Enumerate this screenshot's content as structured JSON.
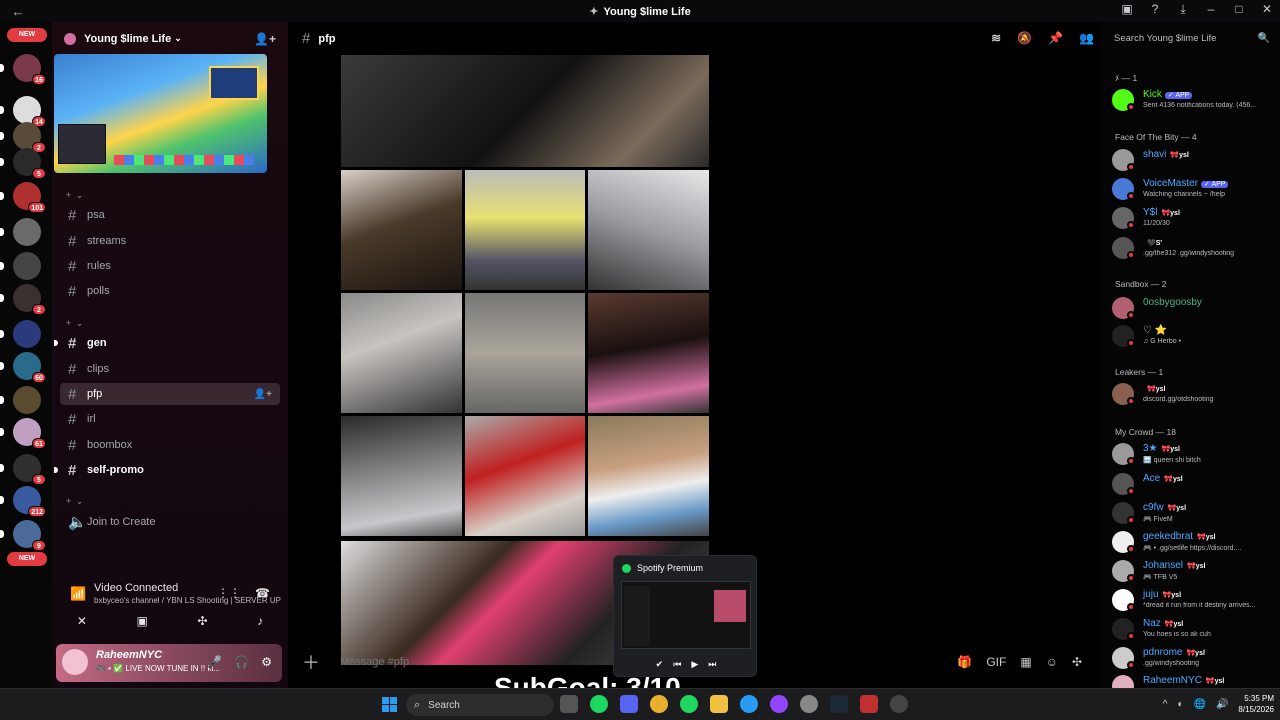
{
  "window": {
    "title": "Young $lime Life",
    "back_icon": "←"
  },
  "rail": {
    "new_label": "NEW",
    "servers": [
      {
        "color": "#7a3a4a",
        "badge": "16"
      },
      {
        "color": "#dddddd",
        "badge": "14"
      },
      {
        "color": "#5a4a3a",
        "badge": "2"
      },
      {
        "color": "#2a2a2a",
        "badge": "5"
      },
      {
        "color": "#b03030",
        "badge": "101"
      },
      {
        "color": "#6a6a6a",
        "badge": ""
      },
      {
        "color": "#444",
        "badge": ""
      },
      {
        "color": "#3a3030",
        "badge": "2"
      },
      {
        "color": "#2a3a7a",
        "badge": ""
      },
      {
        "color": "#2a6a8a",
        "badge": "60"
      },
      {
        "color": "#5a4a30",
        "badge": ""
      },
      {
        "color": "#c0a0c0",
        "badge": "61"
      },
      {
        "color": "#303030",
        "badge": "5"
      },
      {
        "color": "#3a5aa0",
        "badge": "212"
      },
      {
        "color": "#4a6a9a",
        "badge": "9"
      }
    ]
  },
  "server": {
    "name": "Young $lime Life",
    "categories": [
      "+ ⌄",
      "+ ⌄",
      "+ ⌄"
    ],
    "channels": [
      {
        "name": "psa",
        "unread": false
      },
      {
        "name": "streams",
        "unread": false
      },
      {
        "name": "rules",
        "unread": false
      },
      {
        "name": "polls",
        "unread": false
      },
      {
        "name": "gen",
        "unread": true
      },
      {
        "name": "clips",
        "unread": false
      },
      {
        "name": "pfp",
        "unread": false,
        "active": true
      },
      {
        "name": "irl",
        "unread": false
      },
      {
        "name": "boombox",
        "unread": false
      },
      {
        "name": "self-promo",
        "unread": true
      }
    ],
    "voice_channel": "Join to Create"
  },
  "voice": {
    "status": "Video Connected",
    "detail": "bxbyceo's channel / YBN LS Shooting | SERVER UP"
  },
  "user": {
    "name": "RaheemNYC",
    "status": "🎮 • ✅ LIVE NOW TUNE IN !! ki..."
  },
  "channel": {
    "name": "pfp",
    "composer_placeholder": "Message #pfp"
  },
  "spotify": {
    "title": "Spotify Premium"
  },
  "members": {
    "search_placeholder": "Search Young $lime Life",
    "groups": [
      {
        "label": "ﾒ — 1"
      },
      {
        "label": "Face Of The Bity — 4"
      },
      {
        "label": "Sandbox — 2"
      },
      {
        "label": "Leakers — 1"
      },
      {
        "label": "My Crowd — 18"
      }
    ],
    "list": [
      {
        "name": "Kick",
        "color": "#53fc18",
        "tag": "",
        "app": "✓ APP",
        "sub": "Sent 4136 notifications today. (456...",
        "av": "#53fc18"
      },
      {
        "name": "shavi",
        "color": "#4aa8ff",
        "tag": "🎀ysl",
        "app": "",
        "sub": "",
        "av": "#999"
      },
      {
        "name": "VoiceMaster",
        "color": "#4aa8ff",
        "tag": "",
        "app": "✓ APP",
        "sub": "Watching channels ~ /help",
        "av": "#4a7ad8"
      },
      {
        "name": "Y$l",
        "color": "#4aa8ff",
        "tag": "🎀ysl",
        "app": "",
        "sub": "11/20/30",
        "av": "#666"
      },
      {
        "name": "",
        "color": "#4aa8ff",
        "tag": "🖤S'",
        "app": "",
        "sub": ".gg/the312 .gg/windyshooting",
        "av": "#555"
      },
      {
        "name": "0osbygoosby",
        "color": "#43b581",
        "tag": "",
        "app": "",
        "sub": "",
        "av": "#b06070"
      },
      {
        "name": "♡ ⭐",
        "color": "#dcddde",
        "tag": "",
        "app": "",
        "sub": "♫ G Herbo •",
        "av": "#222"
      },
      {
        "name": "",
        "color": "#dcddde",
        "tag": "🎀ysl",
        "app": "",
        "sub": "discord.gg/otdshooting",
        "av": "#8a6050"
      },
      {
        "name": "3★",
        "color": "#4aa8ff",
        "tag": "🎀ysl",
        "app": "",
        "sub": "🔛 queen shi bitch",
        "av": "#999"
      },
      {
        "name": "Ace",
        "color": "#4aa8ff",
        "tag": "🎀ysl",
        "app": "",
        "sub": "",
        "av": "#555"
      },
      {
        "name": "c9fw",
        "color": "#4aa8ff",
        "tag": "🎀ysl",
        "app": "",
        "sub": "🎮 FiveM",
        "av": "#333"
      },
      {
        "name": "geekedbrat",
        "color": "#4aa8ff",
        "tag": "🎀ysl",
        "app": "",
        "sub": "🎮 • .gg/setlife https://discord....",
        "av": "#eee"
      },
      {
        "name": "Johansel",
        "color": "#4aa8ff",
        "tag": "🎀ysl",
        "app": "",
        "sub": "🎮 TFB V5",
        "av": "#aaa"
      },
      {
        "name": "juju",
        "color": "#4aa8ff",
        "tag": "🎀ysl",
        "app": "",
        "sub": "*dread it run from it destiny arrives...",
        "av": "#fff"
      },
      {
        "name": "Naz",
        "color": "#4aa8ff",
        "tag": "🎀ysl",
        "app": "",
        "sub": "You hoes is so  ak cuh",
        "av": "#222"
      },
      {
        "name": "pdnrome",
        "color": "#4aa8ff",
        "tag": "🎀ysl",
        "app": "",
        "sub": ".gg/windyshooting",
        "av": "#ccc"
      },
      {
        "name": "RaheemNYC",
        "color": "#4aa8ff",
        "tag": "🎀ysl",
        "app": "",
        "sub": "",
        "av": "#e0b0c0"
      }
    ]
  },
  "overlay": {
    "subgoal": "SubGoal: 3/10"
  },
  "taskbar": {
    "search": "Search",
    "time": "5:35 PM",
    "date": "8/15/2026"
  }
}
